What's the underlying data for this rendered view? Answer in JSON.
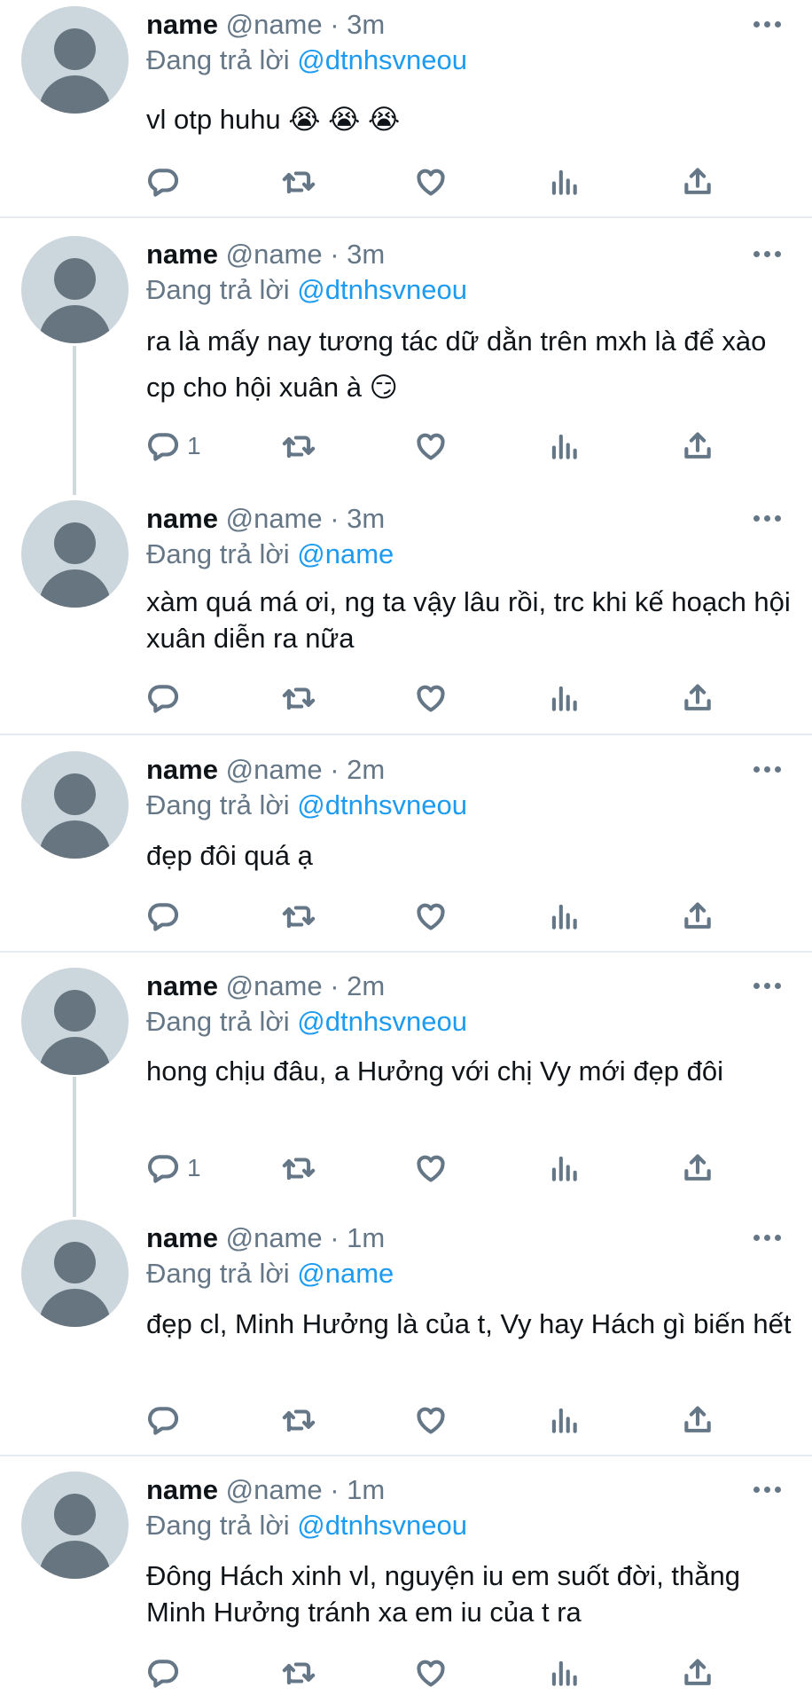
{
  "tweets": [
    {
      "name": "name",
      "meta": "@name · 3m",
      "reply_prefix": "Đang trả lời",
      "reply_handle": "@dtnhsvneou",
      "text": "vl otp huhu 😭 😭 😭",
      "reply_count": ""
    },
    {
      "name": "name",
      "meta": "@name · 3m",
      "reply_prefix": "Đang trả lời",
      "reply_handle": "@dtnhsvneou",
      "text": "ra là mấy nay tương tác dữ dằn trên mxh là để xào cp cho hội xuân à 😏",
      "reply_count": "1"
    },
    {
      "name": "name",
      "meta": "@name · 3m",
      "reply_prefix": "Đang trả lời",
      "reply_handle": "@name",
      "text": "xàm quá má ơi, ng ta vậy lâu rồi, trc khi kế hoạch hội xuân diễn ra nữa",
      "reply_count": ""
    },
    {
      "name": "name",
      "meta": "@name · 2m",
      "reply_prefix": "Đang trả lời",
      "reply_handle": "@dtnhsvneou",
      "text": "đẹp đôi quá ạ",
      "reply_count": ""
    },
    {
      "name": "name",
      "meta": "@name · 2m",
      "reply_prefix": "Đang trả lời",
      "reply_handle": "@dtnhsvneou",
      "text": "hong chịu đâu, a Hưởng với chị Vy mới đẹp đôi",
      "reply_count": "1"
    },
    {
      "name": "name",
      "meta": "@name · 1m",
      "reply_prefix": "Đang trả lời",
      "reply_handle": "@name",
      "text": "đẹp cl, Minh Hưởng là của t, Vy hay Hách gì biến hết",
      "reply_count": ""
    },
    {
      "name": "name",
      "meta": "@name · 1m",
      "reply_prefix": "Đang trả lời",
      "reply_handle": "@dtnhsvneou",
      "text": "Đông Hách xinh vl, nguyện iu em suốt đời, thằng Minh Hưởng tránh xa em iu của t ra",
      "reply_count": ""
    }
  ],
  "icons": {
    "reply": "reply-icon",
    "retweet": "retweet-icon",
    "like": "like-icon",
    "views": "views-icon",
    "share": "share-icon",
    "more": "more-icon"
  },
  "colors": {
    "handle_link": "#1d9bf0",
    "secondary_text": "#657786",
    "avatar_bg": "#ccd6dd",
    "avatar_fg": "#66757f",
    "divider": "#e6ecf0"
  }
}
